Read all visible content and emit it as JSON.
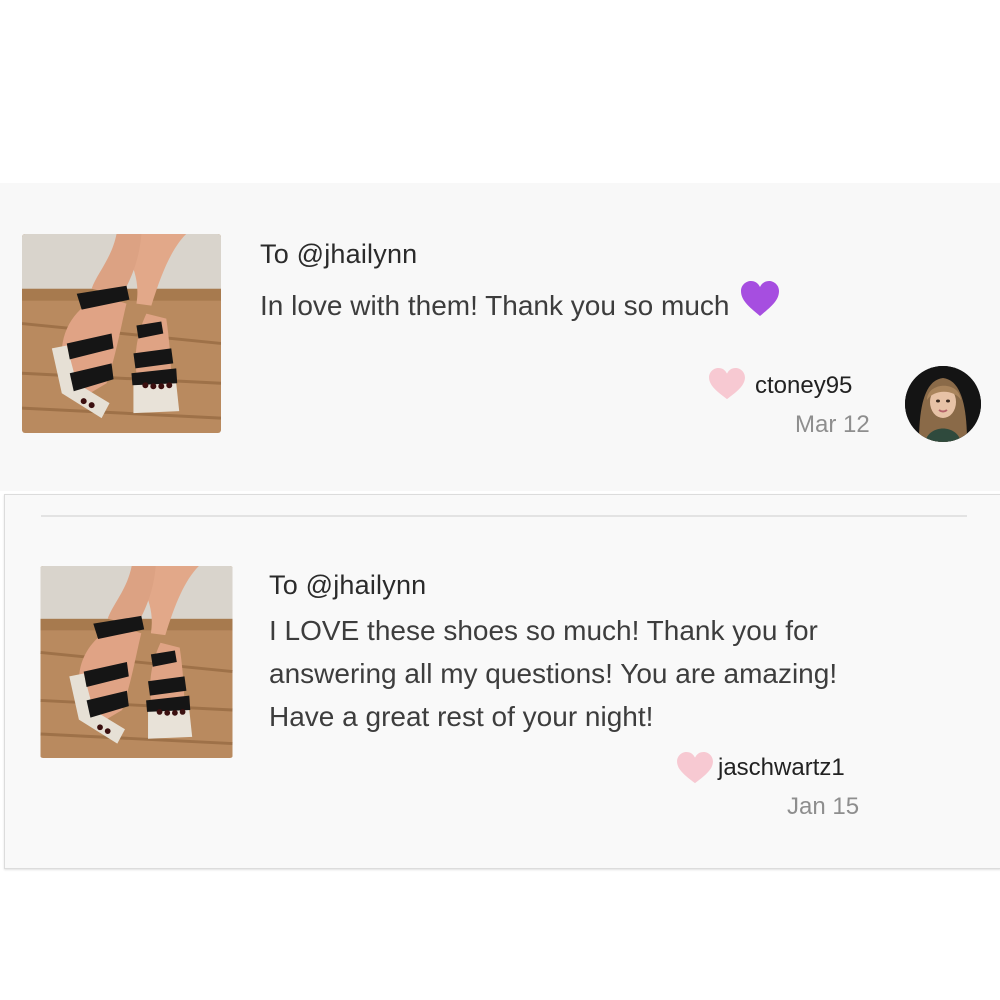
{
  "reviews": [
    {
      "to": "To @jhailynn",
      "message": "In love with them! Thank you so much",
      "emoji": "purple-heart-icon",
      "username": "ctoney95",
      "date": "Mar 12",
      "has_avatar": true
    },
    {
      "to": "To @jhailynn",
      "message_lines": [
        "I LOVE these shoes so much! Thank you for",
        "answering all my questions! You are amazing!",
        "Have a great rest of your night!"
      ],
      "username": "jaschwartz1",
      "date": "Jan 15",
      "has_avatar": false
    }
  ],
  "colors": {
    "card_bg": "#f8f8f8",
    "heart": "#f7c9d2",
    "emoji_heart": "#a64ee0",
    "text_primary": "#2b2b2b",
    "text_secondary": "#8e8e8e"
  }
}
